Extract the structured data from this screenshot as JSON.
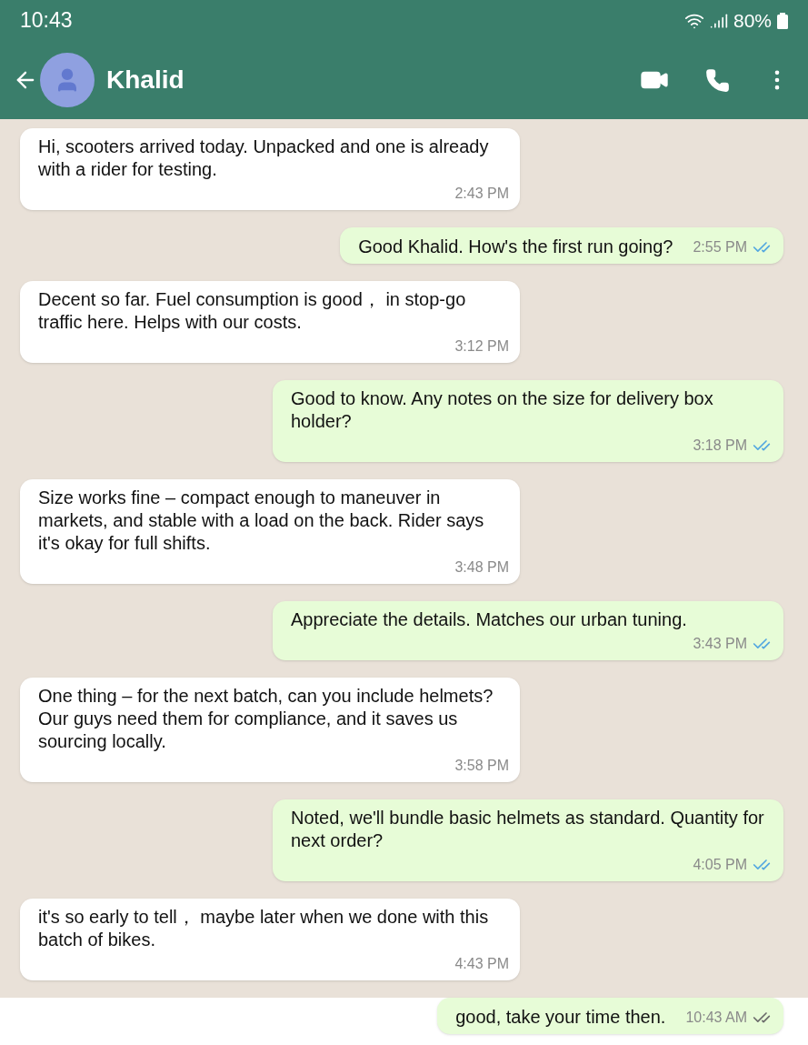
{
  "status_bar": {
    "time": "10:43",
    "battery": "80%"
  },
  "header": {
    "contact_name": "Khalid"
  },
  "messages": [
    {
      "kind": "incoming",
      "text": "Hi, scooters arrived today. Unpacked and one is already with a rider for testing.",
      "time": "2:43 PM"
    },
    {
      "kind": "outgoing",
      "text": "Good Khalid. How's the first run going?",
      "time": "2:55 PM",
      "read": true
    },
    {
      "kind": "incoming",
      "text": "Decent so far. Fuel consumption is good， in stop-go traffic here. Helps with our costs.",
      "time": "3:12 PM"
    },
    {
      "kind": "outgoing",
      "text": "Good to know. Any notes on the size for delivery box holder?",
      "time": "3:18 PM",
      "read": true
    },
    {
      "kind": "incoming",
      "text": "Size works fine – compact enough to maneuver in markets, and stable with a load on the back. Rider says it's okay for full shifts.",
      "time": "3:48 PM"
    },
    {
      "kind": "outgoing",
      "text": "Appreciate the details. Matches our urban tuning.",
      "time": "3:43 PM",
      "read": true
    },
    {
      "kind": "incoming",
      "text": "One thing – for the next batch, can you include helmets? Our guys need them for compliance, and it saves us sourcing locally.",
      "time": "3:58 PM"
    },
    {
      "kind": "outgoing",
      "text": "Noted, we'll bundle basic helmets as standard. Quantity for next order?",
      "time": "4:05 PM",
      "read": true
    },
    {
      "kind": "incoming",
      "text": "it's so early to tell， maybe later when we done with this batch of bikes.",
      "time": "4:43 PM"
    },
    {
      "kind": "outgoing",
      "text": "good, take your time then.",
      "time": "10:43 AM",
      "read": false
    }
  ]
}
